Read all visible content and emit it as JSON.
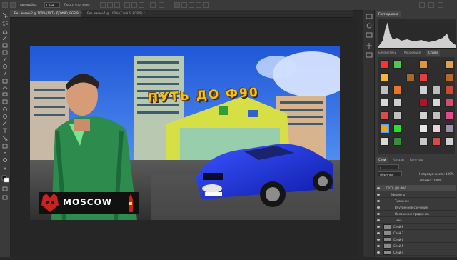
{
  "options_bar": {
    "autoselect_label": "Автовыбор:",
    "autoselect_value": "Слой",
    "transform_label": "Показ. упр. элем."
  },
  "tabs": [
    {
      "label": "Без имени-2 @ 100% (ПУТЬ ДО Ф90, RGB/8) *",
      "active": true
    },
    {
      "label": "Без имени-1 @ 100% (Слой 6, RGB/8) *",
      "active": false
    }
  ],
  "document": {
    "title": "ПУТЬ ДО Ф90",
    "badge": "MOSCOW"
  },
  "panels": {
    "histogram_tab": "Гистограмма",
    "swatch_tabs": [
      "Библиотеки",
      "Коррекция",
      "Стили"
    ],
    "layers_tabs": [
      "Слои",
      "Каналы",
      "Контуры"
    ],
    "blend_mode": "Обычные",
    "opacity": "Непрозрачность: 100%",
    "fill": "Заливка: 100%",
    "layers": [
      {
        "name": "ПУТЬ ДО Ф90",
        "sub": false
      },
      {
        "name": "Эффекты",
        "sub": true
      },
      {
        "name": "Тиснение",
        "sub": true
      },
      {
        "name": "Внутреннее свечение",
        "sub": true
      },
      {
        "name": "Наложение градиента",
        "sub": true
      },
      {
        "name": "Тень",
        "sub": true
      },
      {
        "name": "Слой 8",
        "sub": false
      },
      {
        "name": "Слой 7",
        "sub": false
      },
      {
        "name": "Слой 6",
        "sub": false
      },
      {
        "name": "Слой 5",
        "sub": false
      },
      {
        "name": "Слой 4",
        "sub": false
      }
    ]
  },
  "colors": {
    "title_gold": "#f2c21b",
    "car_blue": "#1c2fd8",
    "jacket_green": "#2e8b4e",
    "badge_red": "#c8231e"
  }
}
